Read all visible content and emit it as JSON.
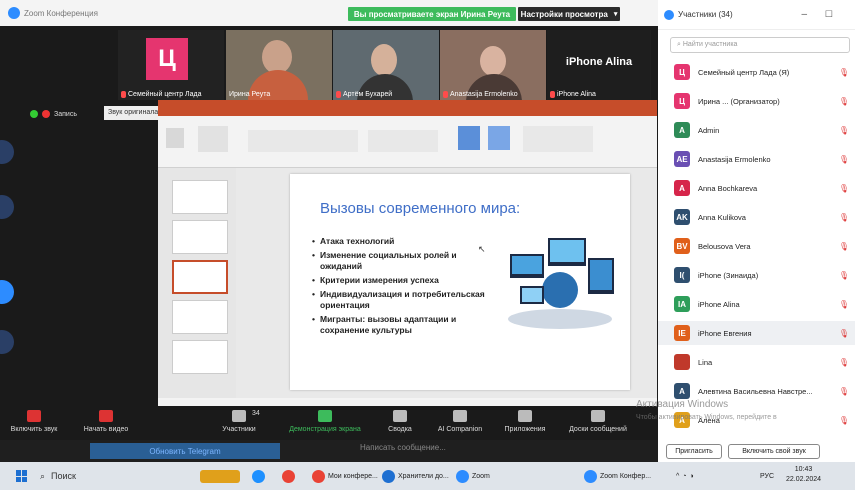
{
  "zoom": {
    "window_title": "Zoom Конференция",
    "share_banner": "Вы просматриваете экран Ирина Реута",
    "view_options": "Настройки просмотра",
    "record_label": "Запись",
    "tooltip": "Звук оригинала для музыкантов: выключено",
    "tiles": [
      {
        "label": "Семейный центр Лада",
        "avatar": "Ц"
      },
      {
        "label": "Ирина Реута"
      },
      {
        "label": "Артём Бухарей"
      },
      {
        "label": "Anastasija Ermolenko"
      },
      {
        "label": "iPhone Alina",
        "big": "iPhone Alina"
      }
    ],
    "toolbar": {
      "mute": "Включить звук",
      "video": "Начать видео",
      "participants": "Участники",
      "participants_count": "34",
      "share": "Демонстрация экрана",
      "summary": "Сводка",
      "ai": "AI Companion",
      "apps": "Приложения",
      "whiteboards": "Доски сообщений"
    },
    "telegram_update": "Обновить Telegram",
    "telegram_msg": "Написать сообщение..."
  },
  "slide": {
    "title": "Вызовы современного мира:",
    "bullets": [
      "Атака технологий",
      "Изменение социальных ролей и ожиданий",
      "Критерии измерения успеха",
      "Индивидуализация и потребительская ориентация",
      "Мигранты: вызовы адаптации и сохранение культуры"
    ]
  },
  "panel": {
    "title": "Участники (34)",
    "search_placeholder": "Найти участника",
    "participants": [
      {
        "name": "Семейный центр Лада (Я)",
        "initials": "Ц",
        "color": "#e5356f"
      },
      {
        "name": "Ирина ... (Организатор)",
        "initials": "Ц",
        "color": "#e5356f"
      },
      {
        "name": "Admin",
        "initials": "A",
        "color": "#2e8b57"
      },
      {
        "name": "Anastasija Ermolenko",
        "initials": "AE",
        "color": "#6a4fb3"
      },
      {
        "name": "Anna Bochkareva",
        "initials": "A",
        "color": "#d6254a"
      },
      {
        "name": "Anna Kulikova",
        "initials": "AK",
        "color": "#2f4f6f"
      },
      {
        "name": "Belousova Vera",
        "initials": "BV",
        "color": "#e0601b"
      },
      {
        "name": "iPhone (Зинаида)",
        "initials": "I(",
        "color": "#2f4f6f"
      },
      {
        "name": "iPhone Alina",
        "initials": "IA",
        "color": "#2e9e5a"
      },
      {
        "name": "iPhone Евгения",
        "initials": "IЕ",
        "color": "#e0601b"
      },
      {
        "name": "Lina",
        "initials": "",
        "color": "#c0392b"
      },
      {
        "name": "Алевтина Васильевна Навстре...",
        "initials": "A",
        "color": "#2f4f6f"
      },
      {
        "name": "Алена",
        "initials": "A",
        "color": "#e0a01b"
      }
    ],
    "invite_button": "Пригласить",
    "unmute_button": "Включить свой звук"
  },
  "activate": {
    "line1": "Активация Windows",
    "line2": "Чтобы активировать Windows, перейдите в"
  },
  "taskbar": {
    "search": "Поиск",
    "items": [
      "Мои конфере...",
      "Хранители до...",
      "Zoom",
      "Zoom Конфер..."
    ],
    "lang": "РУС",
    "time": "10:43",
    "date": "22.02.2024"
  }
}
